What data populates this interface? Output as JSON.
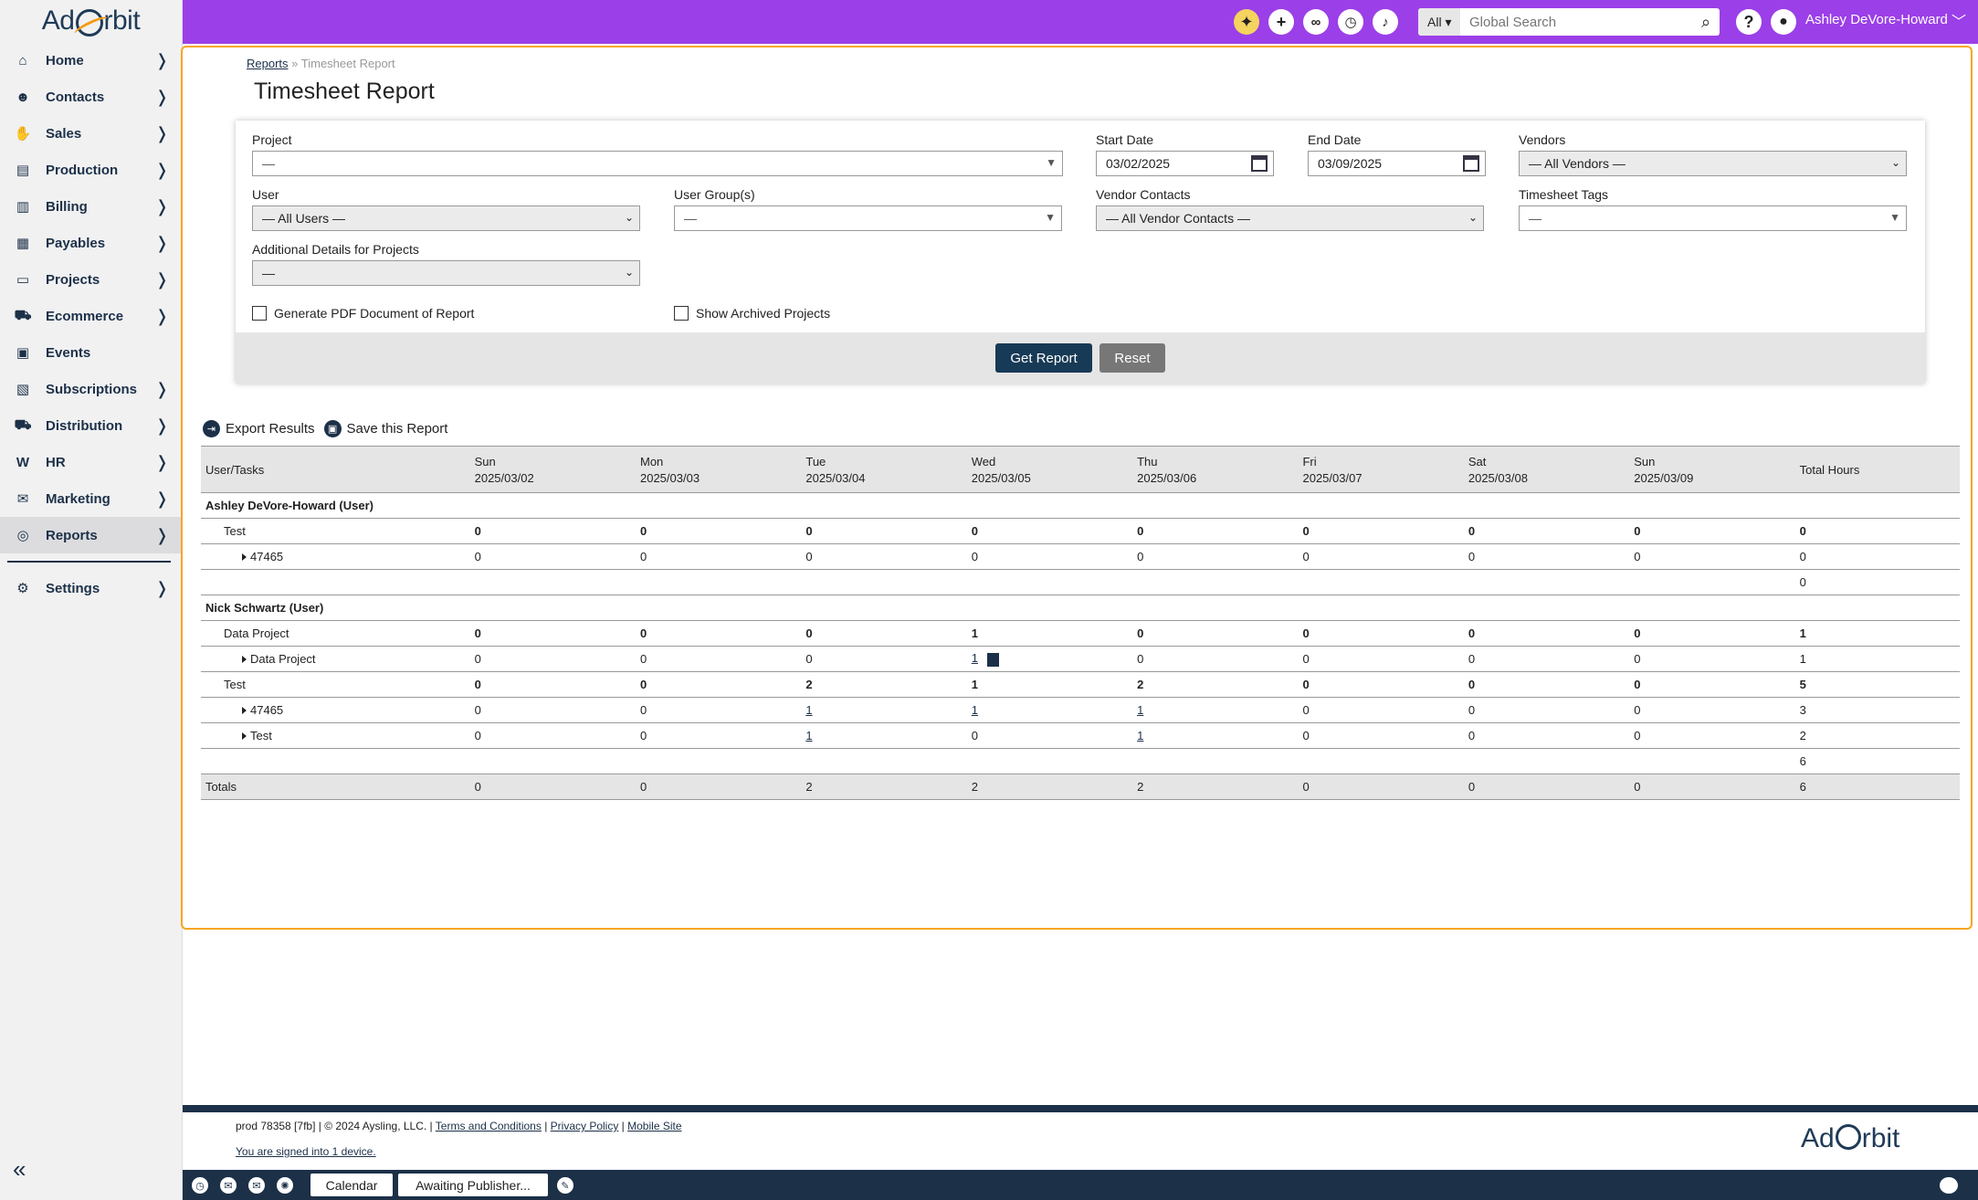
{
  "brand": {
    "name_left": "Ad",
    "name_right": "rbit"
  },
  "sidebar": {
    "items": [
      {
        "label": "Home",
        "icon": "home-icon"
      },
      {
        "label": "Contacts",
        "icon": "contacts-icon"
      },
      {
        "label": "Sales",
        "icon": "handshake-icon"
      },
      {
        "label": "Production",
        "icon": "production-icon"
      },
      {
        "label": "Billing",
        "icon": "billing-icon"
      },
      {
        "label": "Payables",
        "icon": "payables-icon"
      },
      {
        "label": "Projects",
        "icon": "clipboard-icon"
      },
      {
        "label": "Ecommerce",
        "icon": "cart-icon"
      },
      {
        "label": "Events",
        "icon": "calendar-icon"
      },
      {
        "label": "Subscriptions",
        "icon": "subscriptions-icon"
      },
      {
        "label": "Distribution",
        "icon": "truck-icon"
      },
      {
        "label": "HR",
        "icon": "w2-icon"
      },
      {
        "label": "Marketing",
        "icon": "envelope-icon"
      },
      {
        "label": "Reports",
        "icon": "reports-icon"
      }
    ],
    "settings_label": "Settings",
    "active": "Reports"
  },
  "topbar": {
    "search_scope": "All",
    "search_placeholder": "Global Search",
    "user_name": "Ashley DeVore-Howard"
  },
  "breadcrumb": {
    "parent": "Reports",
    "separator": "»",
    "current": "Timesheet Report"
  },
  "page_title": "Timesheet Report",
  "filters": {
    "project": {
      "label": "Project",
      "value": "—"
    },
    "start_date": {
      "label": "Start Date",
      "value": "03/02/2025"
    },
    "end_date": {
      "label": "End Date",
      "value": "03/09/2025"
    },
    "vendors": {
      "label": "Vendors",
      "value": "— All Vendors —"
    },
    "user": {
      "label": "User",
      "value": "— All Users —"
    },
    "user_groups": {
      "label": "User Group(s)",
      "value": "—"
    },
    "vendor_contacts": {
      "label": "Vendor Contacts",
      "value": "— All Vendor Contacts —"
    },
    "timesheet_tags": {
      "label": "Timesheet Tags",
      "value": "—"
    },
    "additional_details": {
      "label": "Additional Details for Projects",
      "value": "—"
    },
    "generate_pdf": "Generate PDF Document of Report",
    "show_archived": "Show Archived Projects",
    "get_report": "Get Report",
    "reset": "Reset"
  },
  "actions": {
    "export": "Export Results",
    "save": "Save this Report"
  },
  "report": {
    "headers": [
      {
        "day": "User/Tasks",
        "date": ""
      },
      {
        "day": "Sun",
        "date": "2025/03/02"
      },
      {
        "day": "Mon",
        "date": "2025/03/03"
      },
      {
        "day": "Tue",
        "date": "2025/03/04"
      },
      {
        "day": "Wed",
        "date": "2025/03/05"
      },
      {
        "day": "Thu",
        "date": "2025/03/06"
      },
      {
        "day": "Fri",
        "date": "2025/03/07"
      },
      {
        "day": "Sat",
        "date": "2025/03/08"
      },
      {
        "day": "Sun",
        "date": "2025/03/09"
      },
      {
        "day": "Total Hours",
        "date": ""
      }
    ],
    "rows": [
      {
        "type": "group",
        "label": "Ashley DeVore-Howard (User)",
        "cells": [
          "",
          "",
          "",
          "",
          "",
          "",
          "",
          "",
          ""
        ]
      },
      {
        "type": "task",
        "label": "Test",
        "cells": [
          "0",
          "0",
          "0",
          "0",
          "0",
          "0",
          "0",
          "0",
          "0"
        ]
      },
      {
        "type": "sub",
        "label": "47465",
        "cells": [
          "0",
          "0",
          "0",
          "0",
          "0",
          "0",
          "0",
          "0",
          "0"
        ]
      },
      {
        "type": "subtotal",
        "label": "",
        "cells": [
          "",
          "",
          "",
          "",
          "",
          "",
          "",
          "",
          "0"
        ]
      },
      {
        "type": "group",
        "label": "Nick Schwartz (User)",
        "cells": [
          "",
          "",
          "",
          "",
          "",
          "",
          "",
          "",
          ""
        ]
      },
      {
        "type": "task",
        "label": "Data Project",
        "cells": [
          "0",
          "0",
          "0",
          "1",
          "0",
          "0",
          "0",
          "0",
          "1"
        ]
      },
      {
        "type": "sub",
        "label": "Data Project",
        "cells": [
          "0",
          "0",
          "0",
          "1",
          "0",
          "0",
          "0",
          "0",
          "1"
        ],
        "links": [
          3
        ],
        "doc": 3
      },
      {
        "type": "task",
        "label": "Test",
        "cells": [
          "0",
          "0",
          "2",
          "1",
          "2",
          "0",
          "0",
          "0",
          "5"
        ]
      },
      {
        "type": "sub",
        "label": "47465",
        "cells": [
          "0",
          "0",
          "1",
          "1",
          "1",
          "0",
          "0",
          "0",
          "3"
        ],
        "links": [
          2,
          3,
          4
        ]
      },
      {
        "type": "sub",
        "label": "Test",
        "cells": [
          "0",
          "0",
          "1",
          "0",
          "1",
          "0",
          "0",
          "0",
          "2"
        ],
        "links": [
          2,
          4
        ]
      },
      {
        "type": "subtotal",
        "label": "",
        "cells": [
          "",
          "",
          "",
          "",
          "",
          "",
          "",
          "",
          "6"
        ]
      },
      {
        "type": "totals",
        "label": "Totals",
        "cells": [
          "0",
          "0",
          "2",
          "2",
          "2",
          "0",
          "0",
          "0",
          "6"
        ]
      }
    ]
  },
  "footer": {
    "build": "prod 78358 [7fb] | © 2024 Aysling, LLC. |",
    "terms": "Terms and Conditions",
    "privacy": "Privacy Policy",
    "mobile": "Mobile Site",
    "signed_in": "You are signed into 1 device."
  },
  "taskbar": {
    "calendar": "Calendar",
    "awaiting": "Awaiting Publisher..."
  }
}
